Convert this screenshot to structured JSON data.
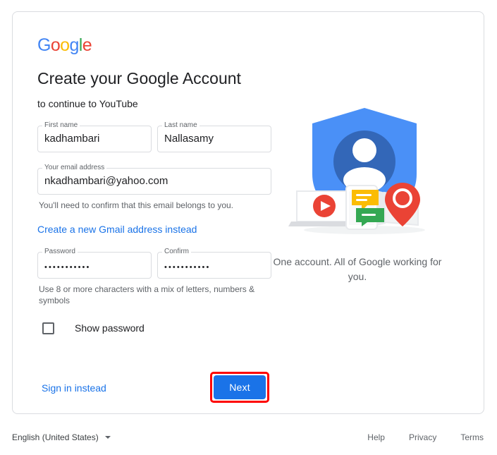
{
  "brand": {
    "logo_letters": [
      {
        "char": "G",
        "color": "#4285f4"
      },
      {
        "char": "o",
        "color": "#ea4335"
      },
      {
        "char": "o",
        "color": "#fbbc05"
      },
      {
        "char": "g",
        "color": "#4285f4"
      },
      {
        "char": "l",
        "color": "#34a853"
      },
      {
        "char": "e",
        "color": "#ea4335"
      }
    ],
    "logo_text": "Google"
  },
  "header": {
    "title": "Create your Google Account",
    "subtitle": "to continue to YouTube"
  },
  "form": {
    "first_name": {
      "label": "First name",
      "value": "kadhambari",
      "placeholder": ""
    },
    "last_name": {
      "label": "Last name",
      "value": "Nallasamy",
      "placeholder": ""
    },
    "email": {
      "label": "Your email address",
      "value": "nkadhambari@yahoo.com",
      "placeholder": "",
      "helper": "You'll need to confirm that this email belongs to you."
    },
    "gmail_link": "Create a new Gmail address instead",
    "password": {
      "label": "Password",
      "value": "•••••••••••",
      "placeholder": ""
    },
    "confirm": {
      "label": "Confirm",
      "value": "•••••••••••",
      "placeholder": ""
    },
    "password_helper": "Use 8 or more characters with a mix of letters, numbers & symbols",
    "show_password": {
      "label": "Show password",
      "checked": false
    }
  },
  "actions": {
    "signin_instead": "Sign in instead",
    "next_label": "Next",
    "next_color": "#1a73e8",
    "highlight_color": "#fe0000"
  },
  "illustration": {
    "caption": "One account. All of Google working for you.",
    "shield_color": "#4a90f7",
    "avatar_color": "#3367b8",
    "play_color": "#ea4335",
    "bubble_yellow": "#fbbc05",
    "bubble_green": "#34a853",
    "pin_color": "#ea4335"
  },
  "footer": {
    "language": "English (United States)",
    "links": [
      "Help",
      "Privacy",
      "Terms"
    ]
  }
}
